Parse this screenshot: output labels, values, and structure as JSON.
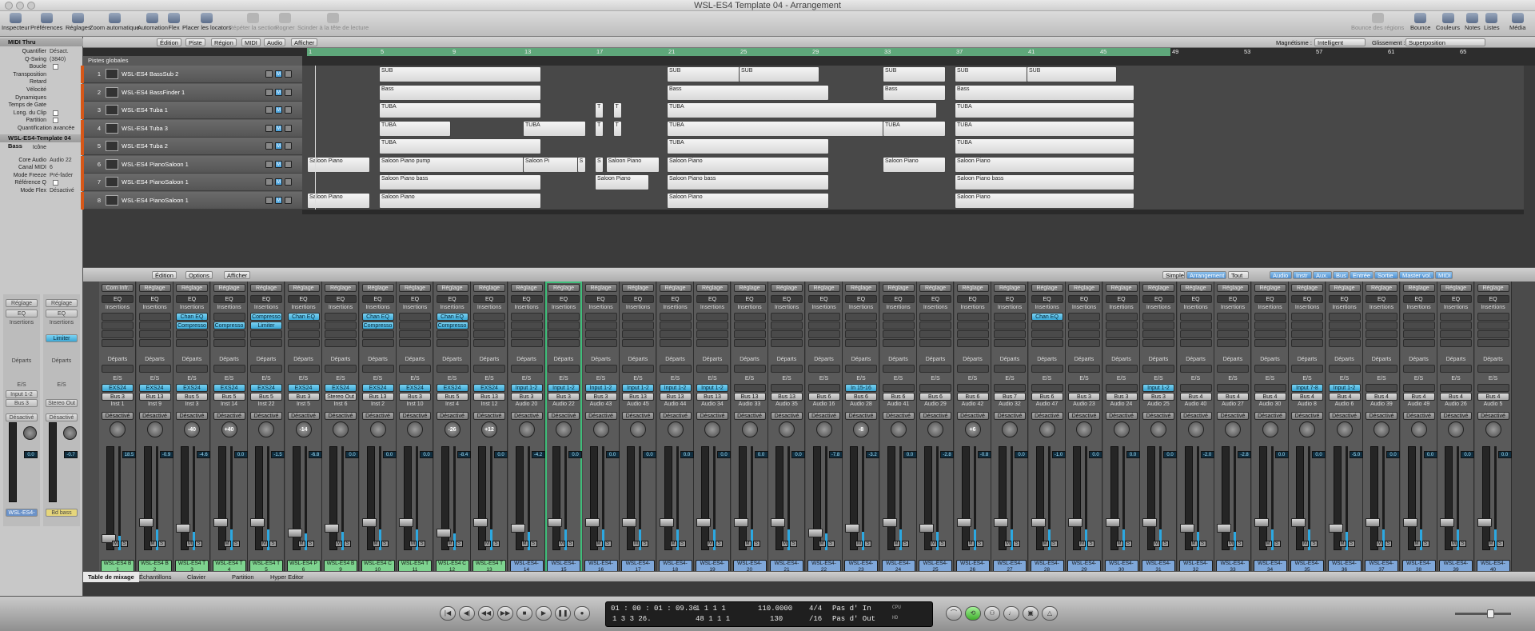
{
  "window": {
    "title": "WSL-ES4 Template 04 - Arrangement"
  },
  "toolbar": {
    "left": [
      {
        "label": "Inspecteur",
        "disabled": false
      },
      {
        "label": "Préférences",
        "disabled": false
      },
      {
        "label": "Réglages",
        "disabled": false
      },
      {
        "label": "Zoom automatique",
        "disabled": false
      },
      {
        "label": "Automation",
        "disabled": false
      },
      {
        "label": "Flex",
        "disabled": false
      },
      {
        "label": "Placer les locators",
        "disabled": false
      },
      {
        "label": "Répéter la section",
        "disabled": true
      },
      {
        "label": "Rogner",
        "disabled": true
      },
      {
        "label": "Scinder à la tête de lecture",
        "disabled": true
      }
    ],
    "right": [
      {
        "label": "Bounce des régions",
        "disabled": true
      },
      {
        "label": "Bounce",
        "disabled": false
      },
      {
        "label": "Couleurs",
        "disabled": false
      },
      {
        "label": "Notes",
        "disabled": false
      },
      {
        "label": "Listes",
        "disabled": false
      },
      {
        "label": "Média",
        "disabled": false
      }
    ]
  },
  "inspector": {
    "header1": "MIDI Thru",
    "region_params": [
      {
        "label": "Quantifier",
        "value": "Désact. (3840)"
      },
      {
        "label": "Q-Swing",
        "value": ""
      },
      {
        "label": "Boucle",
        "value": "",
        "checkbox": true
      },
      {
        "label": "Transposition",
        "value": ""
      },
      {
        "label": "Retard",
        "value": ""
      },
      {
        "label": "Vélocité",
        "value": ""
      },
      {
        "label": "Dynamiques",
        "value": ""
      },
      {
        "label": "Temps de Gate",
        "value": ""
      },
      {
        "label": "Long. du Clip",
        "value": "",
        "checkbox": true
      },
      {
        "label": "Partition",
        "value": "",
        "checkbox": true
      }
    ],
    "advanced": "Quantification avancée",
    "header2": "WSL-ES4-Template 04 Bass",
    "track_params": [
      {
        "label": "Icône",
        "value": ""
      },
      {
        "label": "Core Audio",
        "value": "Audio 22"
      },
      {
        "label": "Canal MIDI",
        "value": "6"
      },
      {
        "label": "Mode Freeze",
        "value": "Pré-fader"
      },
      {
        "label": "Référence Q",
        "value": "",
        "checkbox": true
      },
      {
        "label": "Mode Flex",
        "value": "Désactivé"
      }
    ],
    "strip_a": {
      "settings": "Réglage",
      "eq": "EQ",
      "inserts": "Insertions",
      "sends": "Départs",
      "io": "E/S",
      "input": "Input 1-2",
      "output": "Bus 3",
      "auto": "Désactivé",
      "vol": "0.0",
      "name": "WSL-ES4-"
    },
    "strip_b": {
      "settings": "Réglage",
      "eq": "EQ",
      "inserts": "Insertions",
      "plugin": "Limiter",
      "sends": "Départs",
      "io": "E/S",
      "output": "Stereo Out",
      "auto": "Désactivé",
      "vol": "-0.7",
      "name": "Bd bass"
    }
  },
  "arrange_bar": {
    "buttons": [
      "Édition",
      "Piste",
      "Région",
      "MIDI",
      "Audio",
      "Afficher"
    ],
    "snap_label": "Magnétisme :",
    "snap_value": "Intelligent",
    "drag_label": "Glissement :",
    "drag_value": "Superposition"
  },
  "ruler": [
    "1",
    "5",
    "9",
    "13",
    "17",
    "21",
    "25",
    "29",
    "33",
    "37",
    "41",
    "45",
    "49",
    "53",
    "57",
    "61",
    "65"
  ],
  "global_tracks": "Pistes globales",
  "tracks": [
    {
      "num": "1",
      "name": "WSL-ES4 BassSub 2"
    },
    {
      "num": "2",
      "name": "WSL-ES4 BassFinder 1"
    },
    {
      "num": "3",
      "name": "WSL-ES4 Tuba 1"
    },
    {
      "num": "4",
      "name": "WSL-ES4 Tuba 3"
    },
    {
      "num": "5",
      "name": "WSL-ES4 Tuba 2"
    },
    {
      "num": "6",
      "name": "WSL-ES4 PianoSaloon 1"
    },
    {
      "num": "7",
      "name": "WSL-ES4 PianoSaloon 1"
    },
    {
      "num": "8",
      "name": "WSL-ES4 PianoSaloon 1"
    }
  ],
  "regions": [
    {
      "row": 0,
      "bar": 5,
      "len": 18,
      "label": "SUB"
    },
    {
      "row": 0,
      "bar": 21,
      "len": 10,
      "label": "SUB"
    },
    {
      "row": 0,
      "bar": 25,
      "len": 9,
      "label": "SUB"
    },
    {
      "row": 0,
      "bar": 33,
      "len": 7,
      "label": "SUB"
    },
    {
      "row": 0,
      "bar": 37,
      "len": 10,
      "label": "SUB"
    },
    {
      "row": 0,
      "bar": 41,
      "len": 10,
      "label": "SUB"
    },
    {
      "row": 1,
      "bar": 5,
      "len": 18,
      "label": "Bass"
    },
    {
      "row": 1,
      "bar": 21,
      "len": 18,
      "label": "Bass"
    },
    {
      "row": 1,
      "bar": 33,
      "len": 7,
      "label": "Bass"
    },
    {
      "row": 1,
      "bar": 37,
      "len": 20,
      "label": "Bass"
    },
    {
      "row": 2,
      "bar": 5,
      "len": 18,
      "label": "TUBA"
    },
    {
      "row": 2,
      "bar": 17,
      "len": 1,
      "label": "T"
    },
    {
      "row": 2,
      "bar": 18,
      "len": 1,
      "label": "T"
    },
    {
      "row": 2,
      "bar": 21,
      "len": 30,
      "label": "TUBA"
    },
    {
      "row": 2,
      "bar": 37,
      "len": 20,
      "label": "TUBA"
    },
    {
      "row": 3,
      "bar": 5,
      "len": 8,
      "label": "TUBA"
    },
    {
      "row": 3,
      "bar": 13,
      "len": 7,
      "label": "TUBA"
    },
    {
      "row": 3,
      "bar": 17,
      "len": 1,
      "label": "T"
    },
    {
      "row": 3,
      "bar": 18,
      "len": 1,
      "label": "T"
    },
    {
      "row": 3,
      "bar": 21,
      "len": 30,
      "label": "TUBA"
    },
    {
      "row": 3,
      "bar": 33,
      "len": 7,
      "label": "TUBA"
    },
    {
      "row": 3,
      "bar": 37,
      "len": 20,
      "label": "TUBA"
    },
    {
      "row": 4,
      "bar": 5,
      "len": 18,
      "label": "TUBA"
    },
    {
      "row": 4,
      "bar": 21,
      "len": 18,
      "label": "TUBA"
    },
    {
      "row": 4,
      "bar": 37,
      "len": 20,
      "label": "TUBA"
    },
    {
      "row": 5,
      "bar": 1,
      "len": 7,
      "label": "Saloon Piano"
    },
    {
      "row": 5,
      "bar": 5,
      "len": 18,
      "label": "Saloon Piano pump"
    },
    {
      "row": 5,
      "bar": 13,
      "len": 7,
      "label": "Saloon Pi"
    },
    {
      "row": 5,
      "bar": 16,
      "len": 1,
      "label": "S"
    },
    {
      "row": 5,
      "bar": 17,
      "len": 1,
      "label": "S"
    },
    {
      "row": 5,
      "bar": 17.6,
      "len": 6,
      "label": "Saloon Piano"
    },
    {
      "row": 5,
      "bar": 21,
      "len": 18,
      "label": "Saloon Piano"
    },
    {
      "row": 5,
      "bar": 33,
      "len": 7,
      "label": "Saloon Piano"
    },
    {
      "row": 5,
      "bar": 37,
      "len": 20,
      "label": "Saloon Piano"
    },
    {
      "row": 6,
      "bar": 5,
      "len": 18,
      "label": "Saloon Piano bass"
    },
    {
      "row": 6,
      "bar": 17,
      "len": 6,
      "label": "Saloon Piano"
    },
    {
      "row": 6,
      "bar": 21,
      "len": 18,
      "label": "Saloon Piano bass"
    },
    {
      "row": 6,
      "bar": 37,
      "len": 20,
      "label": "Saloon Piano bass"
    },
    {
      "row": 7,
      "bar": 1,
      "len": 7,
      "label": "Saloon Piano"
    },
    {
      "row": 7,
      "bar": 5,
      "len": 18,
      "label": "Saloon Piano"
    },
    {
      "row": 7,
      "bar": 21,
      "len": 18,
      "label": "Saloon Piano"
    },
    {
      "row": 7,
      "bar": 37,
      "len": 20,
      "label": "Saloon Piano"
    }
  ],
  "mixer_bar": {
    "buttons": [
      "Édition",
      "Options",
      "Afficher"
    ],
    "views": [
      "Simple",
      "Arrangement",
      "Tout"
    ],
    "filters": [
      "Audio",
      "Instr",
      "Aux.",
      "Bus",
      "Entrée",
      "Sortie",
      "Master vol.",
      "MIDI"
    ]
  },
  "mixer_labels": {
    "settings": "Réglage",
    "eq": "EQ",
    "inserts": "Insertions",
    "sends": "Départs",
    "io": "E/S",
    "auto": "Désactivé"
  },
  "strips": [
    {
      "settings": "Corn Infr.",
      "plugins": [],
      "input": "EXS24",
      "output": "Bus 3",
      "sub": "Inst 1",
      "pan": "",
      "vol": "18.5",
      "name": "WSL-ES4 B",
      "num": "1",
      "color": "#7ed38f",
      "level": 0.35
    },
    {
      "settings": "Réglage",
      "plugins": [],
      "input": "EXS24",
      "output": "Bus 13",
      "sub": "Inst 9",
      "pan": "",
      "vol": "-0.9",
      "name": "WSL-ES4 B",
      "num": "2",
      "color": "#7ed38f",
      "level": 0.5
    },
    {
      "settings": "Réglage",
      "plugins": [
        "Chan EQ",
        "Compresso"
      ],
      "input": "EXS24",
      "output": "Bus 5",
      "sub": "Inst 3",
      "pan": "-40",
      "vol": "-4.6",
      "name": "WSL-ES4 T",
      "num": "3",
      "color": "#7ed38f",
      "level": 0.45
    },
    {
      "settings": "Réglage",
      "plugins": [
        "",
        "Compresso"
      ],
      "input": "EXS24",
      "output": "Bus 5",
      "sub": "Inst 14",
      "pan": "+40",
      "vol": "0.0",
      "name": "WSL-ES4 T",
      "num": "4",
      "color": "#7ed38f",
      "level": 0.5
    },
    {
      "settings": "Réglage",
      "plugins": [
        "Compresso",
        "Limiter"
      ],
      "input": "EXS24",
      "output": "Bus 5",
      "sub": "Inst 22",
      "pan": "",
      "vol": "-1.5",
      "name": "WSL-ES4 T",
      "num": "5",
      "color": "#7ed38f",
      "level": 0.5
    },
    {
      "settings": "Réglage",
      "plugins": [
        "Chan EQ"
      ],
      "input": "EXS24",
      "output": "Bus 3",
      "sub": "Inst 5",
      "pan": "-14",
      "vol": "-6.8",
      "name": "WSL-ES4 P",
      "num": "6",
      "color": "#7ed38f",
      "level": 0.4
    },
    {
      "settings": "Réglage",
      "plugins": [],
      "input": "EXS24",
      "output": "Stereo Out",
      "sub": "Inst 6",
      "pan": "",
      "vol": "0.0",
      "name": "WSL-ES4 B",
      "num": "9",
      "color": "#7ed38f",
      "level": 0.45
    },
    {
      "settings": "Réglage",
      "plugins": [
        "Chan EQ",
        "Compresso"
      ],
      "input": "EXS24",
      "output": "Bus 13",
      "sub": "Inst 2",
      "pan": "",
      "vol": "0.0",
      "name": "WSL-ES4 C",
      "num": "10",
      "color": "#7ed38f",
      "level": 0.5
    },
    {
      "settings": "Réglage",
      "plugins": [],
      "input": "EXS24",
      "output": "Bus 3",
      "sub": "Inst 10",
      "pan": "",
      "vol": "0.0",
      "name": "WSL-ES4 T",
      "num": "11",
      "color": "#7ed38f",
      "level": 0.5
    },
    {
      "settings": "Réglage",
      "plugins": [
        "Chan EQ",
        "Compresso"
      ],
      "input": "EXS24",
      "output": "Bus 5",
      "sub": "Inst 4",
      "pan": "-26",
      "vol": "-8.4",
      "name": "WSL-ES4 C",
      "num": "12",
      "color": "#7ed38f",
      "level": 0.4
    },
    {
      "settings": "Réglage",
      "plugins": [],
      "input": "EXS24",
      "output": "Bus 13",
      "sub": "Inst 12",
      "pan": "+12",
      "vol": "0.0",
      "name": "WSL-ES4 T",
      "num": "13",
      "color": "#7ed38f",
      "level": 0.5
    },
    {
      "settings": "Réglage",
      "plugins": [],
      "input": "Input 1-2",
      "output": "Bus 3",
      "sub": "Audio 20",
      "pan": "",
      "vol": "-4.2",
      "name": "WSL-ES4-",
      "num": "14",
      "color": "#7fa7d9",
      "level": 0.45
    },
    {
      "settings": "Réglage",
      "plugins": [],
      "input": "Input 1-2",
      "output": "Bus 3",
      "sub": "Audio 22",
      "pan": "",
      "vol": "0.0",
      "name": "WSL-ES4-",
      "num": "15",
      "color": "#7fa7d9",
      "level": 0.5,
      "selected": true
    },
    {
      "settings": "Réglage",
      "plugins": [],
      "input": "Input 1-2",
      "output": "Bus 3",
      "sub": "Audio 43",
      "pan": "",
      "vol": "0.0",
      "name": "WSL-ES4-",
      "num": "16",
      "color": "#7fa7d9",
      "level": 0.5
    },
    {
      "settings": "Réglage",
      "plugins": [],
      "input": "Input 1-2",
      "output": "Bus 13",
      "sub": "Audio 45",
      "pan": "",
      "vol": "0.0",
      "name": "WSL-ES4-",
      "num": "17",
      "color": "#7fa7d9",
      "level": 0.5
    },
    {
      "settings": "Réglage",
      "plugins": [],
      "input": "Input 1-2",
      "output": "Bus 13",
      "sub": "Audio 44",
      "pan": "",
      "vol": "0.0",
      "name": "WSL-ES4-",
      "num": "18",
      "color": "#7fa7d9",
      "level": 0.5
    },
    {
      "settings": "Réglage",
      "plugins": [],
      "input": "Input 1-2",
      "output": "Bus 13",
      "sub": "Audio 34",
      "pan": "",
      "vol": "0.0",
      "name": "WSL-ES4-",
      "num": "19",
      "color": "#7fa7d9",
      "level": 0.5
    },
    {
      "settings": "Réglage",
      "plugins": [],
      "input": "",
      "output": "Bus 13",
      "sub": "Audio 33",
      "pan": "",
      "vol": "0.0",
      "name": "WSL-ES4-",
      "num": "20",
      "color": "#7fa7d9",
      "level": 0.5
    },
    {
      "settings": "Réglage",
      "plugins": [],
      "input": "",
      "output": "Bus 13",
      "sub": "Audio 35",
      "pan": "",
      "vol": "0.0",
      "name": "WSL-ES4-",
      "num": "21",
      "color": "#7fa7d9",
      "level": 0.5
    },
    {
      "settings": "Réglage",
      "plugins": [],
      "input": "",
      "output": "Bus 6",
      "sub": "Audio 16",
      "pan": "",
      "vol": "-7.8",
      "name": "WSL-ES4-",
      "num": "22",
      "color": "#7fa7d9",
      "level": 0.4
    },
    {
      "settings": "Réglage",
      "plugins": [],
      "input": "In 15-16",
      "output": "Bus 6",
      "sub": "Audio 28",
      "pan": "-8",
      "vol": "-3.2",
      "name": "WSL-ES4-",
      "num": "23",
      "color": "#7fa7d9",
      "level": 0.45
    },
    {
      "settings": "Réglage",
      "plugins": [],
      "input": "",
      "output": "Bus 6",
      "sub": "Audio 41",
      "pan": "",
      "vol": "0.0",
      "name": "WSL-ES4-",
      "num": "24",
      "color": "#7fa7d9",
      "level": 0.5
    },
    {
      "settings": "Réglage",
      "plugins": [],
      "input": "",
      "output": "Bus 6",
      "sub": "Audio 29",
      "pan": "",
      "vol": "-2.8",
      "name": "WSL-ES4-",
      "num": "25",
      "color": "#7fa7d9",
      "level": 0.45
    },
    {
      "settings": "Réglage",
      "plugins": [],
      "input": "",
      "output": "Bus 6",
      "sub": "Audio 42",
      "pan": "+6",
      "vol": "-0.8",
      "name": "WSL-ES4-",
      "num": "26",
      "color": "#7fa7d9",
      "level": 0.5
    },
    {
      "settings": "Réglage",
      "plugins": [],
      "input": "",
      "output": "Bus 7",
      "sub": "Audio 32",
      "pan": "",
      "vol": "0.0",
      "name": "WSL-ES4-",
      "num": "27",
      "color": "#7fa7d9",
      "level": 0.5
    },
    {
      "settings": "Réglage",
      "plugins": [
        "Chan EQ"
      ],
      "input": "",
      "output": "Bus 6",
      "sub": "Audio 47",
      "pan": "",
      "vol": "-1.0",
      "name": "WSL-ES4-",
      "num": "28",
      "color": "#7fa7d9",
      "level": 0.5
    },
    {
      "settings": "Réglage",
      "plugins": [],
      "input": "",
      "output": "Bus 3",
      "sub": "Audio 23",
      "pan": "",
      "vol": "0.0",
      "name": "WSL-ES4-",
      "num": "29",
      "color": "#7fa7d9",
      "level": 0.5
    },
    {
      "settings": "Réglage",
      "plugins": [],
      "input": "",
      "output": "Bus 3",
      "sub": "Audio 24",
      "pan": "",
      "vol": "0.0",
      "name": "WSL-ES4-",
      "num": "30",
      "color": "#7fa7d9",
      "level": 0.5
    },
    {
      "settings": "Réglage",
      "plugins": [],
      "input": "Input 1-2",
      "output": "Bus 3",
      "sub": "Audio 25",
      "pan": "",
      "vol": "0.0",
      "name": "WSL-ES4-",
      "num": "31",
      "color": "#7fa7d9",
      "level": 0.5
    },
    {
      "settings": "Réglage",
      "plugins": [],
      "input": "",
      "output": "Bus 4",
      "sub": "Audio 40",
      "pan": "",
      "vol": "-2.0",
      "name": "WSL-ES4-",
      "num": "32",
      "color": "#7fa7d9",
      "level": 0.45
    },
    {
      "settings": "Réglage",
      "plugins": [],
      "input": "",
      "output": "Bus 4",
      "sub": "Audio 27",
      "pan": "",
      "vol": "-2.8",
      "name": "WSL-ES4-",
      "num": "33",
      "color": "#7fa7d9",
      "level": 0.45
    },
    {
      "settings": "Réglage",
      "plugins": [],
      "input": "",
      "output": "Bus 4",
      "sub": "Audio 30",
      "pan": "",
      "vol": "0.0",
      "name": "WSL-ES4-",
      "num": "34",
      "color": "#7fa7d9",
      "level": 0.5
    },
    {
      "settings": "Réglage",
      "plugins": [],
      "input": "Input 7-8",
      "output": "Bus 4",
      "sub": "Audio 8",
      "pan": "",
      "vol": "0.0",
      "name": "WSL-ES4-",
      "num": "35",
      "color": "#7fa7d9",
      "level": 0.5
    },
    {
      "settings": "Réglage",
      "plugins": [],
      "input": "Input 1-2",
      "output": "Bus 4",
      "sub": "Audio 6",
      "pan": "",
      "vol": "-5.0",
      "name": "WSL-ES4-",
      "num": "36",
      "color": "#7fa7d9",
      "level": 0.45
    },
    {
      "settings": "Réglage",
      "plugins": [],
      "input": "",
      "output": "Bus 4",
      "sub": "Audio 39",
      "pan": "",
      "vol": "0.0",
      "name": "WSL-ES4-",
      "num": "37",
      "color": "#7fa7d9",
      "level": 0.5
    },
    {
      "settings": "Réglage",
      "plugins": [],
      "input": "",
      "output": "Bus 4",
      "sub": "Audio 49",
      "pan": "",
      "vol": "0.0",
      "name": "WSL-ES4-",
      "num": "38",
      "color": "#7fa7d9",
      "level": 0.5
    },
    {
      "settings": "Réglage",
      "plugins": [],
      "input": "",
      "output": "Bus 4",
      "sub": "Audio 26",
      "pan": "",
      "vol": "0.0",
      "name": "WSL-ES4-",
      "num": "39",
      "color": "#7fa7d9",
      "level": 0.5
    },
    {
      "settings": "Réglage",
      "plugins": [],
      "input": "",
      "output": "Bus 4",
      "sub": "Audio 5",
      "pan": "",
      "vol": "0.0",
      "name": "WSL-ES4-",
      "num": "40",
      "color": "#7fa7d9",
      "level": 0.5
    }
  ],
  "mixer_tabs": [
    "Table de mixage",
    "Échantillons",
    "Clavier",
    "Partition",
    "Hyper Editor"
  ],
  "transport": {
    "smpte": "01 : 00 : 01 : 09.36",
    "smpte_sub": "1  1  1  1",
    "bars": "1   3   3   26.",
    "bars_sub": "48   1   1   1",
    "tempo": "110.0000",
    "tempo_sub": "130",
    "sig": "4/4",
    "div": "/16",
    "in": "Pas d' In",
    "out": "Pas d' Out",
    "cpu": "CPU",
    "hd": "HD"
  }
}
